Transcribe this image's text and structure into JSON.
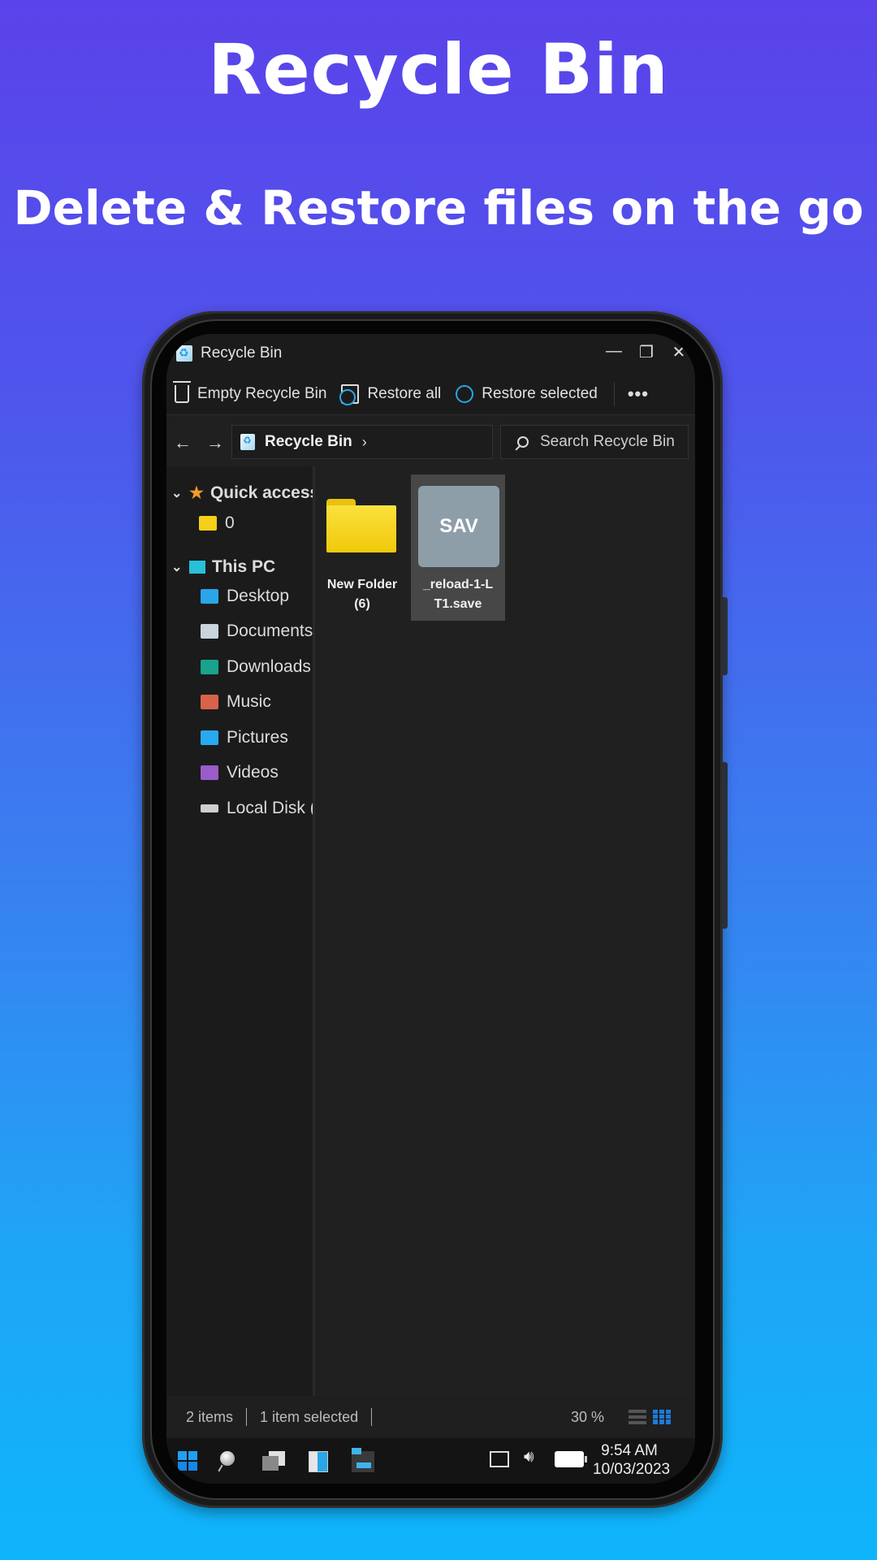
{
  "hero": {
    "title": "Recycle Bin",
    "subtitle": "Delete & Restore files on the go"
  },
  "window": {
    "title": "Recycle Bin",
    "controls": {
      "minimize": "—",
      "maximize": "❐",
      "close": "✕"
    }
  },
  "toolbar": {
    "empty_label": "Empty Recycle Bin",
    "restore_all_label": "Restore all",
    "restore_selected_label": "Restore selected",
    "more_label": "•••"
  },
  "address": {
    "back": "←",
    "forward": "→",
    "breadcrumb": "Recycle Bin",
    "chevron": "›",
    "search_placeholder": "Search Recycle Bin"
  },
  "sidebar": {
    "quick_access": {
      "label": "Quick access",
      "items": [
        {
          "label": "0",
          "icon": "folder-icon"
        }
      ]
    },
    "this_pc": {
      "label": "This PC",
      "items": [
        {
          "label": "Desktop",
          "icon": "desktop-icon",
          "color": "#2aa5e8"
        },
        {
          "label": "Documents",
          "icon": "documents-icon",
          "color": "#c9d4dc"
        },
        {
          "label": "Downloads",
          "icon": "downloads-icon",
          "color": "#1aa38c"
        },
        {
          "label": "Music",
          "icon": "music-icon",
          "color": "#d8624a"
        },
        {
          "label": "Pictures",
          "icon": "pictures-icon",
          "color": "#29a9ef"
        },
        {
          "label": "Videos",
          "icon": "videos-icon",
          "color": "#9a5cc8"
        },
        {
          "label": "Local Disk (C:)",
          "icon": "disk-icon",
          "color": "#cfcfcf"
        }
      ]
    }
  },
  "files": [
    {
      "name": "New Folder (6)",
      "line1": "New Folder",
      "line2": "(6)",
      "type": "folder",
      "selected": false
    },
    {
      "name": "_reload-1-LT1.save",
      "line1": "_reload-1-L",
      "line2": "T1.save",
      "type": "file",
      "badge": "SAV",
      "selected": true
    }
  ],
  "status": {
    "item_count": "2 items",
    "selection": "1 item selected",
    "zoom": "30 %"
  },
  "taskbar": {
    "time": "9:54 AM",
    "date": "10/03/2023"
  }
}
